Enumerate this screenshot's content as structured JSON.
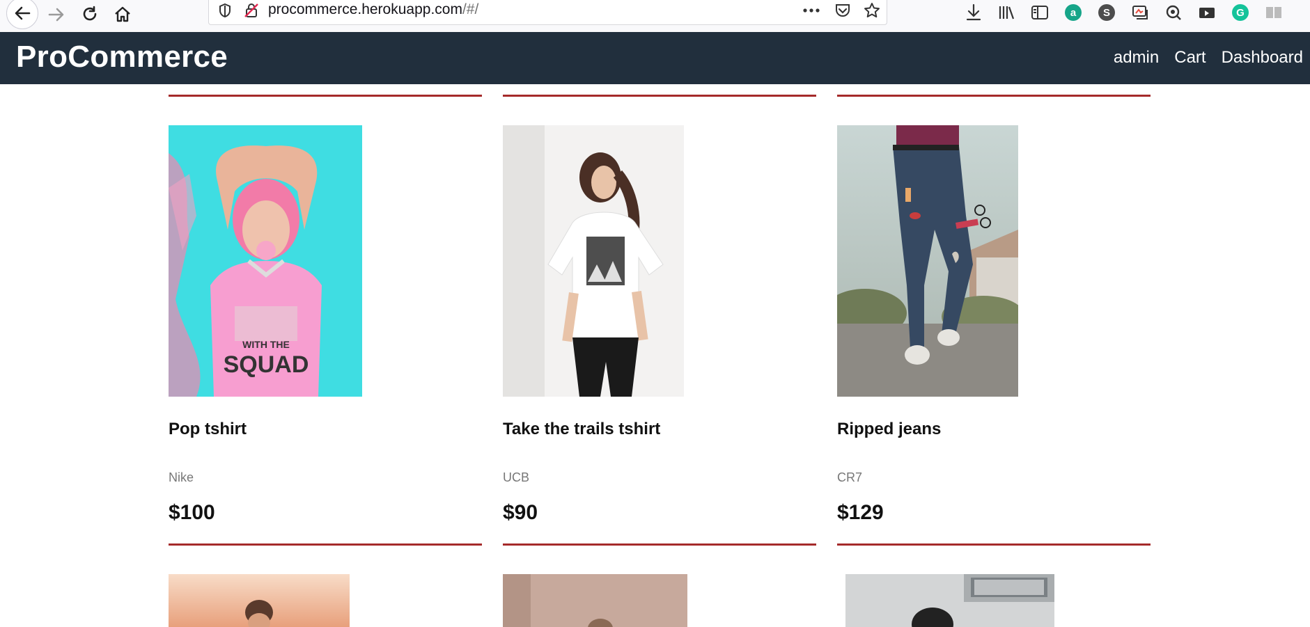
{
  "browser": {
    "url_host": "procommerce.herokuapp.com",
    "url_path": "/#/"
  },
  "header": {
    "brand": "ProCommerce",
    "nav": [
      "admin",
      "Cart",
      "Dashboard"
    ]
  },
  "products": [
    {
      "name": "Pop tshirt",
      "brand": "Nike",
      "price": "$100"
    },
    {
      "name": "Take the trails tshirt",
      "brand": "UCB",
      "price": "$90"
    },
    {
      "name": "Ripped jeans",
      "brand": "CR7",
      "price": "$129"
    }
  ],
  "colors": {
    "header_bg": "#212f3d",
    "divider": "#a52a2a"
  }
}
